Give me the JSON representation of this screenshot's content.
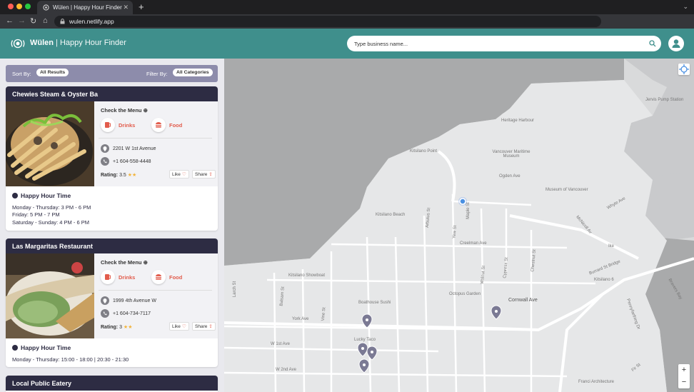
{
  "browser": {
    "tab_title": "Wülen | Happy Hour Finder",
    "url": "wulen.netlify.app",
    "close_glyph": "✕",
    "newtab_glyph": "+",
    "tabmenu_glyph": "⌄",
    "back_glyph": "←",
    "forward_glyph": "→",
    "reload_glyph": "↻",
    "home_glyph": "⌂",
    "traffic_lights": [
      "#ff5f57",
      "#febc2e",
      "#28c840"
    ]
  },
  "header": {
    "brand_name": "Wülen",
    "brand_sep": " | ",
    "brand_subtitle": "Happy Hour Finder",
    "search_placeholder": "Type business name...",
    "accent_color": "#3f8f8c"
  },
  "filters": {
    "sort_label": "Sort By:",
    "sort_value": "All Results",
    "filter_label": "Filter By:",
    "filter_value": "All Categories"
  },
  "cards": [
    {
      "name": "Chewies Steam & Oyster Ba",
      "menu_link": "Check the Menu",
      "menu_icon": "⊕",
      "category_drinks": "Drinks",
      "category_food": "Food",
      "address": "2201 W 1st Avenue",
      "phone": "+1 604-558-4448",
      "rating_label": "Rating:",
      "rating_value": "3.5",
      "rating_stars": 3.5,
      "like_label": "Like",
      "share_label": "Share",
      "happy_hour_title": "Happy Hour Time",
      "hours": [
        "Monday - Thursday: 3 PM - 6 PM",
        "Friday: 5 PM - 7 PM",
        "Saturday - Sunday: 4 PM - 6 PM"
      ]
    },
    {
      "name": "Las Margaritas Restaurant",
      "menu_link": "Check the Menu",
      "menu_icon": "⊕",
      "category_drinks": "Drinks",
      "category_food": "Food",
      "address": "1999 4th Avenue W",
      "phone": "+1 604-734-7117",
      "rating_label": "Rating:",
      "rating_value": "3",
      "rating_stars": 3,
      "like_label": "Like",
      "share_label": "Share",
      "happy_hour_title": "Happy Hour Time",
      "hours": [
        "Monday - Thursday: 15:00 - 18:00 | 20:30 - 21:30"
      ]
    },
    {
      "name": "Local Public Eatery"
    }
  ],
  "map": {
    "labels": [
      "Jervis Pump Station",
      "Heritage Harbour",
      "Kitsilano Point",
      "Vancouver Maritime Museum",
      "Ogden Ave",
      "Museum of Vancouver",
      "Kitsilano Beach",
      "Maple St",
      "Arbutus St",
      "Yew St",
      "Walnut St",
      "Cypress St",
      "Chestnut St",
      "McNicoll Av",
      "Whyte Ave",
      "Creelman Ave",
      "Burrard St Bridge",
      "Kitsilano 6",
      "Kitsilano Showboat",
      "Octopus Garden",
      "Cornwall Ave",
      "Boathouse Sushi",
      "York Ave",
      "W 1st Ave",
      "W 2nd Ave",
      "Larch St",
      "Balsam St",
      "Vine St",
      "Lucky Taco",
      "Pennyfarthing Dr",
      "Fir St",
      "Franci Architecture",
      "Ike",
      "Bravers Bay"
    ],
    "zoom_in": "+",
    "zoom_out": "−"
  }
}
